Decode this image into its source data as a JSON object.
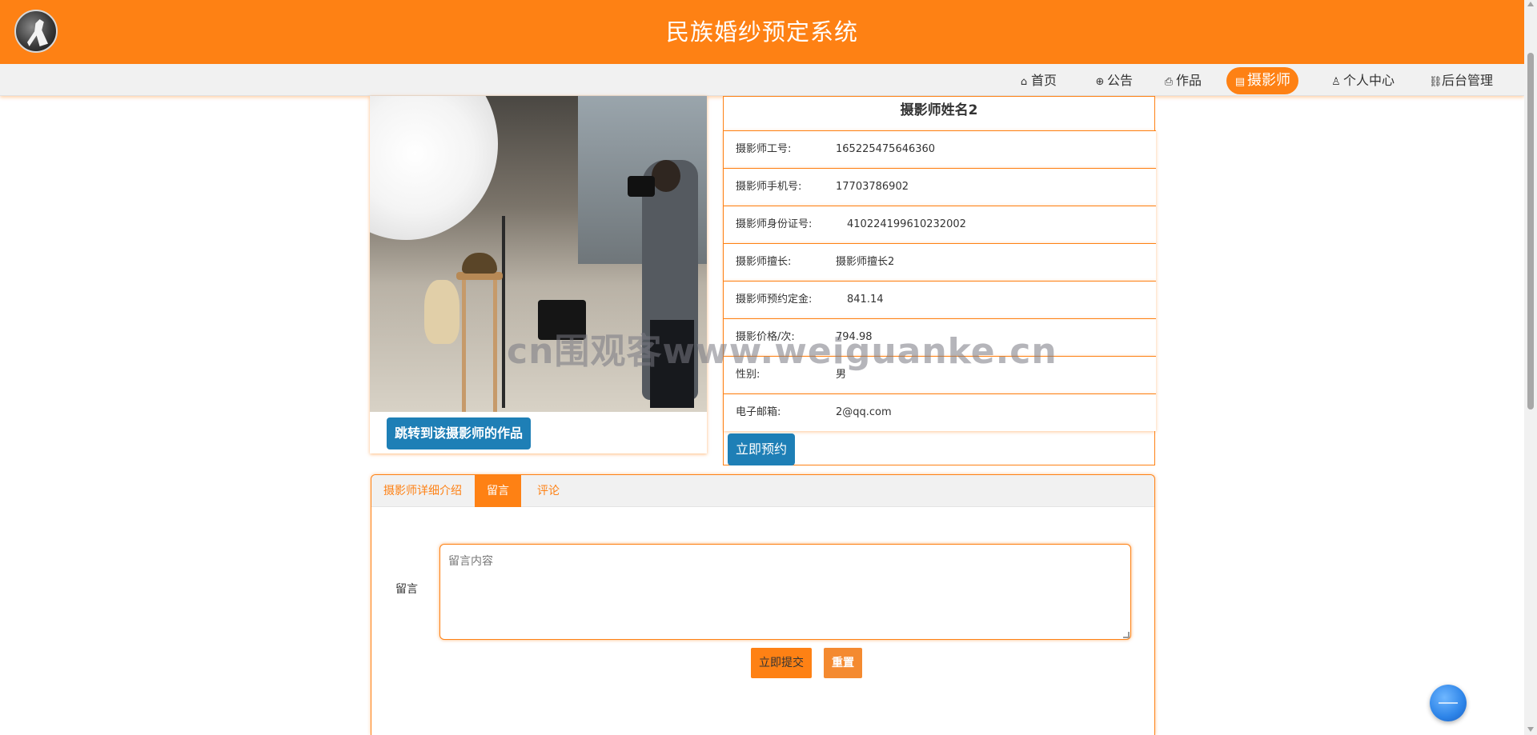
{
  "header": {
    "site_title": "民族婚纱预定系统"
  },
  "nav": {
    "items": [
      {
        "label": "首页",
        "icon": "home-icon",
        "glyph": "⌂"
      },
      {
        "label": "公告",
        "icon": "globe-icon",
        "glyph": "⊕"
      },
      {
        "label": "作品",
        "icon": "printer-icon",
        "glyph": "⎙"
      },
      {
        "label": "摄影师",
        "icon": "document-icon",
        "glyph": "▤",
        "active": true
      },
      {
        "label": "个人中心",
        "icon": "user-icon",
        "glyph": "♙"
      },
      {
        "label": "后台管理",
        "icon": "link-icon",
        "glyph": "⛓"
      }
    ]
  },
  "photographer": {
    "works_button": "跳转到该摄影师的作品",
    "name": "摄影师姓名2",
    "fields": [
      {
        "label": "摄影师工号:",
        "value": "165225475646360"
      },
      {
        "label": "摄影师手机号:",
        "value": "17703786902"
      },
      {
        "label": "摄影师身份证号:",
        "value": "410224199610232002"
      },
      {
        "label": "摄影师擅长:",
        "value": "摄影师擅长2"
      },
      {
        "label": "摄影师预约定金:",
        "value": "841.14"
      },
      {
        "label": "摄影价格/次:",
        "value": "794.98"
      },
      {
        "label": "性别:",
        "value": "男"
      },
      {
        "label": "电子邮箱:",
        "value": "2@qq.com"
      }
    ],
    "book_button": "立即预约"
  },
  "watermark": "cn围观客www.weiguanke.cn",
  "tabs": {
    "items": [
      {
        "label": "摄影师详细介绍"
      },
      {
        "label": "留言",
        "active": true
      },
      {
        "label": "评论"
      }
    ]
  },
  "message_form": {
    "label": "留言",
    "placeholder": "留言内容",
    "value": "",
    "submit_label": "立即提交",
    "reset_label": "重置"
  },
  "colors": {
    "brand_orange": "#fe8114",
    "button_blue": "#1e7fb6"
  }
}
